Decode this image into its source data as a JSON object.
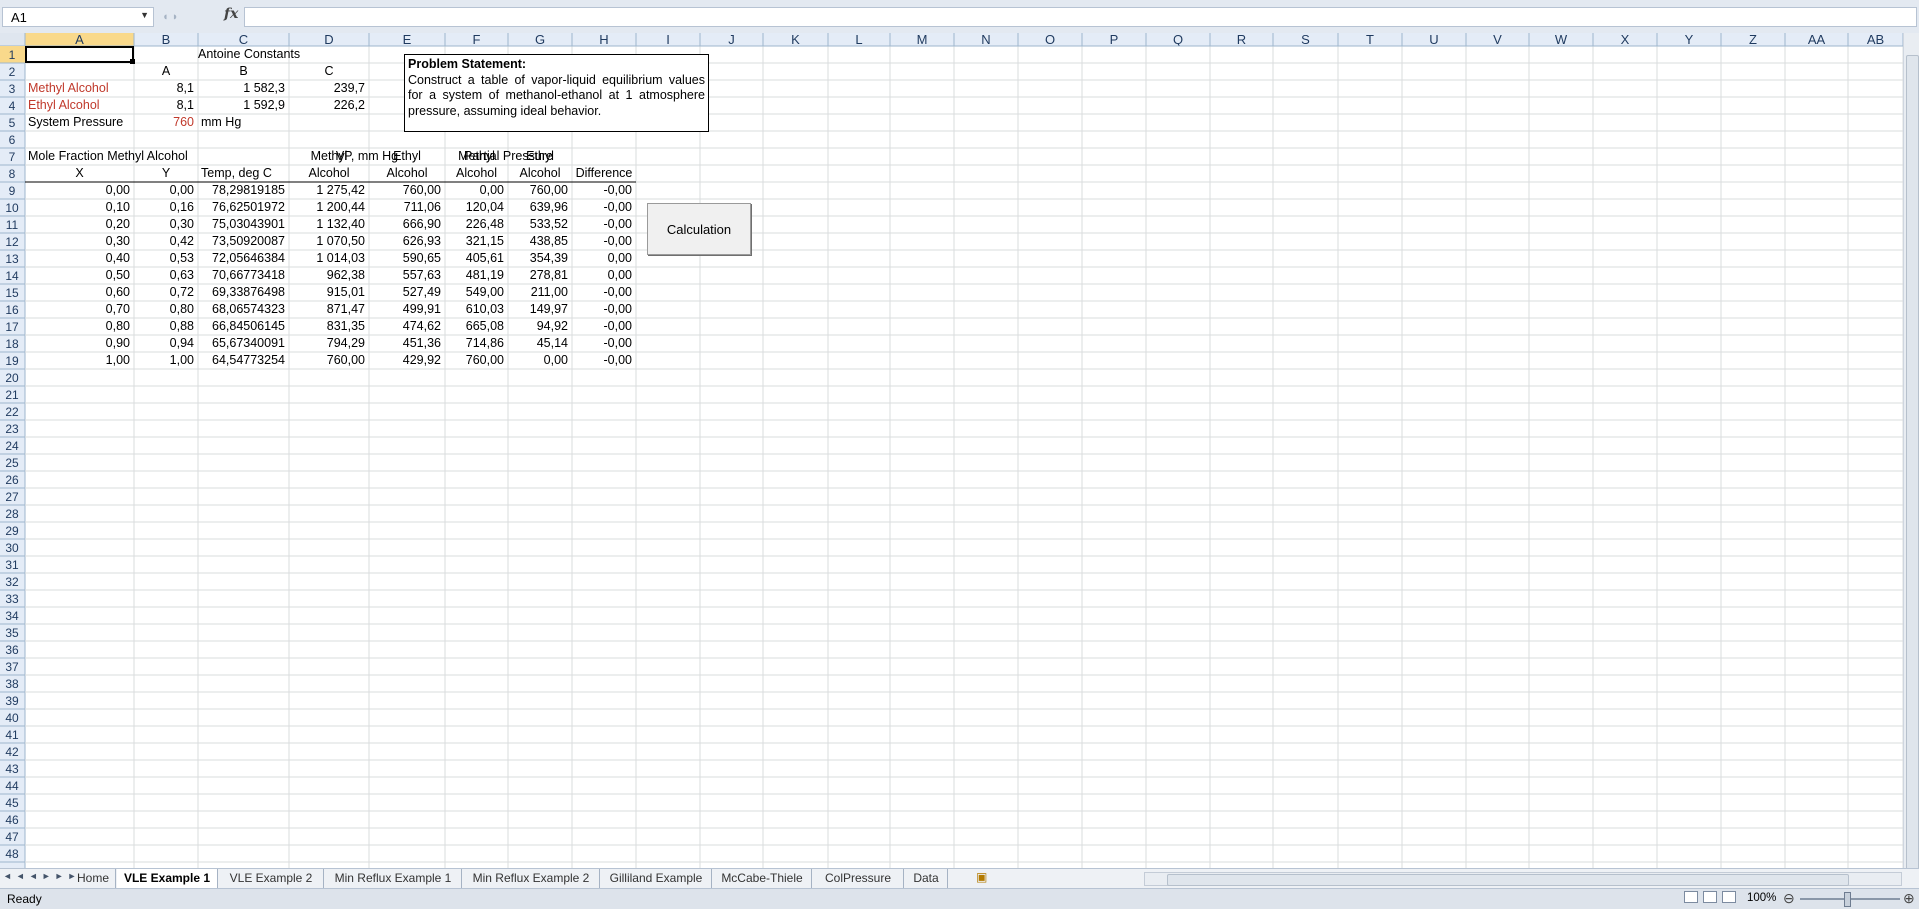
{
  "namebox": {
    "value": "A1"
  },
  "formula_bar": {
    "fx_label": "fx",
    "content": ""
  },
  "columns": [
    "A",
    "B",
    "C",
    "D",
    "E",
    "F",
    "G",
    "H",
    "I",
    "J",
    "K",
    "L",
    "M",
    "N",
    "O",
    "P",
    "Q",
    "R",
    "S",
    "T",
    "U",
    "V",
    "W",
    "X",
    "Y",
    "Z",
    "AA",
    "AB"
  ],
  "selected": {
    "column": "A",
    "row": 1
  },
  "constants": {
    "title": "Antoine Constants",
    "hdr_a": "A",
    "hdr_b": "B",
    "hdr_c": "C",
    "methyl_label": "Methyl Alcohol",
    "methyl_a": "8,1",
    "methyl_b": "1 582,3",
    "methyl_c": "239,7",
    "ethyl_label": "Ethyl Alcohol",
    "ethyl_a": "8,1",
    "ethyl_b": "1 592,9",
    "ethyl_c": "226,2",
    "pressure_label": "System Pressure",
    "pressure_value": "760",
    "pressure_unit": "mm Hg"
  },
  "table_headers": {
    "mole_fraction": "Mole Fraction Methyl Alcohol",
    "vp": "VP, mm Hg",
    "partial": "Partial Pressure",
    "x": "X",
    "y": "Y",
    "temp": "Temp, deg C",
    "d_top": "Methyl",
    "d_bottom": "Alcohol",
    "e_top": "Ethyl",
    "e_bottom": "Alcohol",
    "f_top": "Methyl",
    "f_bottom": "Alcohol",
    "g_top": "Ethyl",
    "g_bottom": "Alcohol",
    "difference": "Difference"
  },
  "table_rows": [
    [
      "0,00",
      "0,00",
      "78,29819185",
      "1 275,42",
      "760,00",
      "0,00",
      "760,00",
      "-0,00"
    ],
    [
      "0,10",
      "0,16",
      "76,62501972",
      "1 200,44",
      "711,06",
      "120,04",
      "639,96",
      "-0,00"
    ],
    [
      "0,20",
      "0,30",
      "75,03043901",
      "1 132,40",
      "666,90",
      "226,48",
      "533,52",
      "-0,00"
    ],
    [
      "0,30",
      "0,42",
      "73,50920087",
      "1 070,50",
      "626,93",
      "321,15",
      "438,85",
      "-0,00"
    ],
    [
      "0,40",
      "0,53",
      "72,05646384",
      "1 014,03",
      "590,65",
      "405,61",
      "354,39",
      "0,00"
    ],
    [
      "0,50",
      "0,63",
      "70,66773418",
      "962,38",
      "557,63",
      "481,19",
      "278,81",
      "0,00"
    ],
    [
      "0,60",
      "0,72",
      "69,33876498",
      "915,01",
      "527,49",
      "549,00",
      "211,00",
      "-0,00"
    ],
    [
      "0,70",
      "0,80",
      "68,06574323",
      "871,47",
      "499,91",
      "610,03",
      "149,97",
      "-0,00"
    ],
    [
      "0,80",
      "0,88",
      "66,84506145",
      "831,35",
      "474,62",
      "665,08",
      "94,92",
      "-0,00"
    ],
    [
      "0,90",
      "0,94",
      "65,67340091",
      "794,29",
      "451,36",
      "714,86",
      "45,14",
      "-0,00"
    ],
    [
      "1,00",
      "1,00",
      "64,54773254",
      "760,00",
      "429,92",
      "760,00",
      "0,00",
      "-0,00"
    ]
  ],
  "problem": {
    "title": "Problem Statement:",
    "text": "Construct a table of vapor-liquid equilibrium values for a system of methanol-ethanol at 1 atmosphere pressure, assuming ideal behavior."
  },
  "calc_button": {
    "label": "Calculation"
  },
  "sheet_tabs": [
    "Home",
    "VLE Example 1",
    "VLE Example 2",
    "Min Reflux Example 1",
    "Min Reflux Example 2",
    "Gilliland Example",
    "McCabe-Thiele",
    "ColPressure",
    "Data"
  ],
  "active_tab": "VLE Example 1",
  "status": {
    "text": "Ready",
    "zoom": "100%"
  },
  "colors": {
    "accent_red": "#c0392b",
    "header_bg": "#e4ecf7",
    "selected_header": "#f9d98b",
    "grid": "#dadcdd"
  }
}
